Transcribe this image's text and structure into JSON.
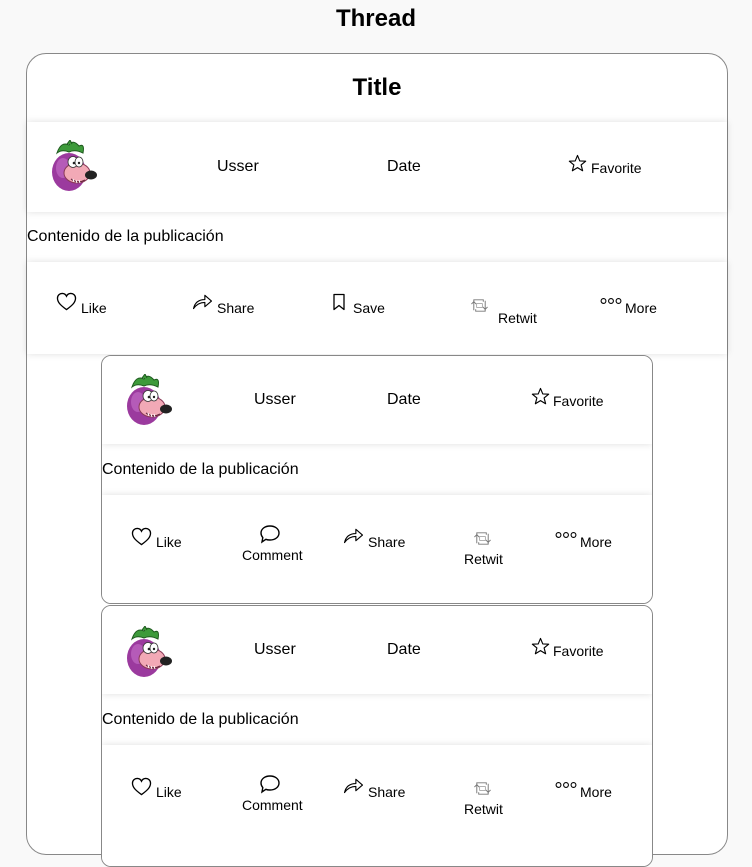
{
  "page": {
    "title": "Thread"
  },
  "main_post": {
    "title": "Title",
    "user": "Usser",
    "date": "Date",
    "favorite": "Favorite",
    "content": "Contenido de la publicación",
    "actions": {
      "like": "Like",
      "share": "Share",
      "save": "Save",
      "retwit": "Retwit",
      "more": "More"
    }
  },
  "replies": [
    {
      "user": "Usser",
      "date": "Date",
      "favorite": "Favorite",
      "content": "Contenido de la publicación",
      "actions": {
        "like": "Like",
        "comment": "Comment",
        "share": "Share",
        "retwit": "Retwit",
        "more": "More"
      }
    },
    {
      "user": "Usser",
      "date": "Date",
      "favorite": "Favorite",
      "content": "Contenido de la publicación",
      "actions": {
        "like": "Like",
        "comment": "Comment",
        "share": "Share",
        "retwit": "Retwit",
        "more": "More"
      }
    }
  ],
  "icons": {
    "avatar": "eggplant-cartoon-avatar",
    "favorite": "star-outline-icon",
    "like": "heart-outline-icon",
    "share": "share-arrow-icon",
    "save": "bookmark-icon",
    "retwit": "retweet-icon",
    "more": "three-dots-icon",
    "comment": "speech-bubble-icon"
  }
}
